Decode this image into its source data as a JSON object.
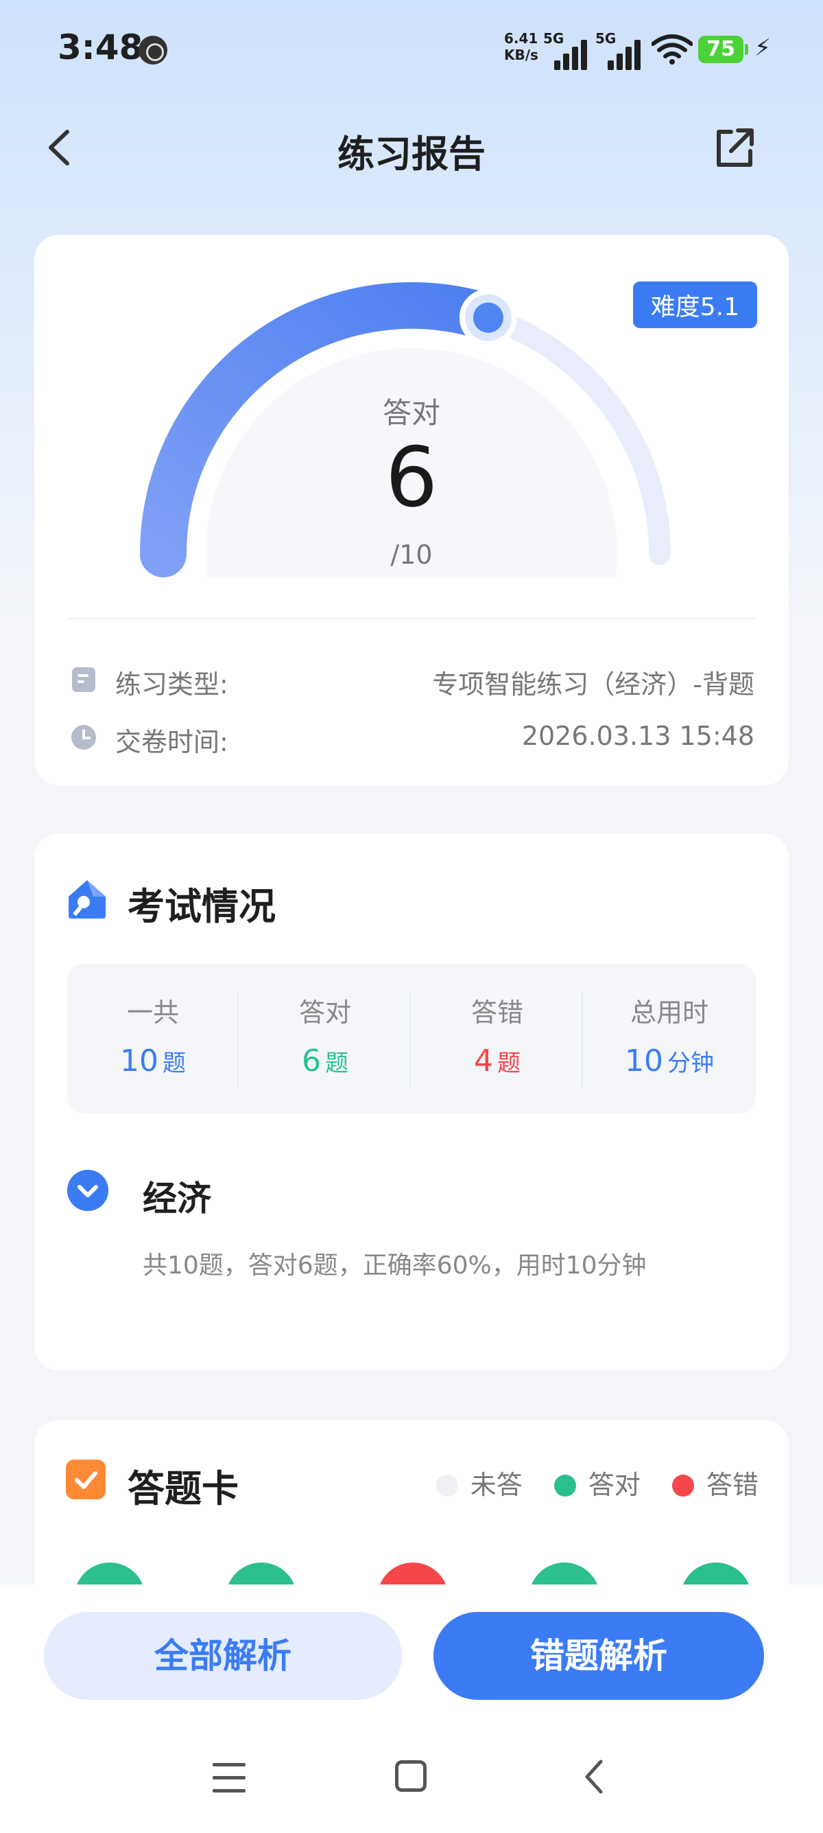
{
  "status_bar": {
    "time": "3:48",
    "net_speed_value": "6.41",
    "net_speed_unit": "KB/s",
    "sim1_label": "5G",
    "sim2_label": "5G",
    "battery": "75"
  },
  "nav": {
    "title": "练习报告"
  },
  "score": {
    "difficulty_badge": "难度5.1",
    "label": "答对",
    "correct": "6",
    "total": "/10",
    "progress_fraction": 0.6
  },
  "info": {
    "type_label": "练习类型:",
    "type_value": "专项智能练习（经济）-背题",
    "time_label": "交卷时间:",
    "time_value": "2026.03.13 15:48"
  },
  "exam": {
    "title": "考试情况",
    "stats": [
      {
        "key": "一共",
        "value": "10",
        "unit": "题"
      },
      {
        "key": "答对",
        "value": "6",
        "unit": "题"
      },
      {
        "key": "答错",
        "value": "4",
        "unit": "题"
      },
      {
        "key": "总用时",
        "value": "10",
        "unit": "分钟"
      }
    ],
    "subject": {
      "name": "经济",
      "desc": "共10题，答对6题，正确率60%，用时10分钟"
    }
  },
  "answer_sheet": {
    "title": "答题卡",
    "legend": {
      "unanswered": "未答",
      "correct": "答对",
      "wrong": "答错"
    },
    "visible_results": [
      "correct",
      "correct",
      "wrong",
      "correct",
      "correct"
    ]
  },
  "colors": {
    "accent": "#3b7cf4",
    "correct": "#2cc08c",
    "wrong": "#f5474a",
    "unanswered": "#eef0f4"
  },
  "buttons": {
    "all_analysis": "全部解析",
    "wrong_analysis": "错题解析"
  }
}
